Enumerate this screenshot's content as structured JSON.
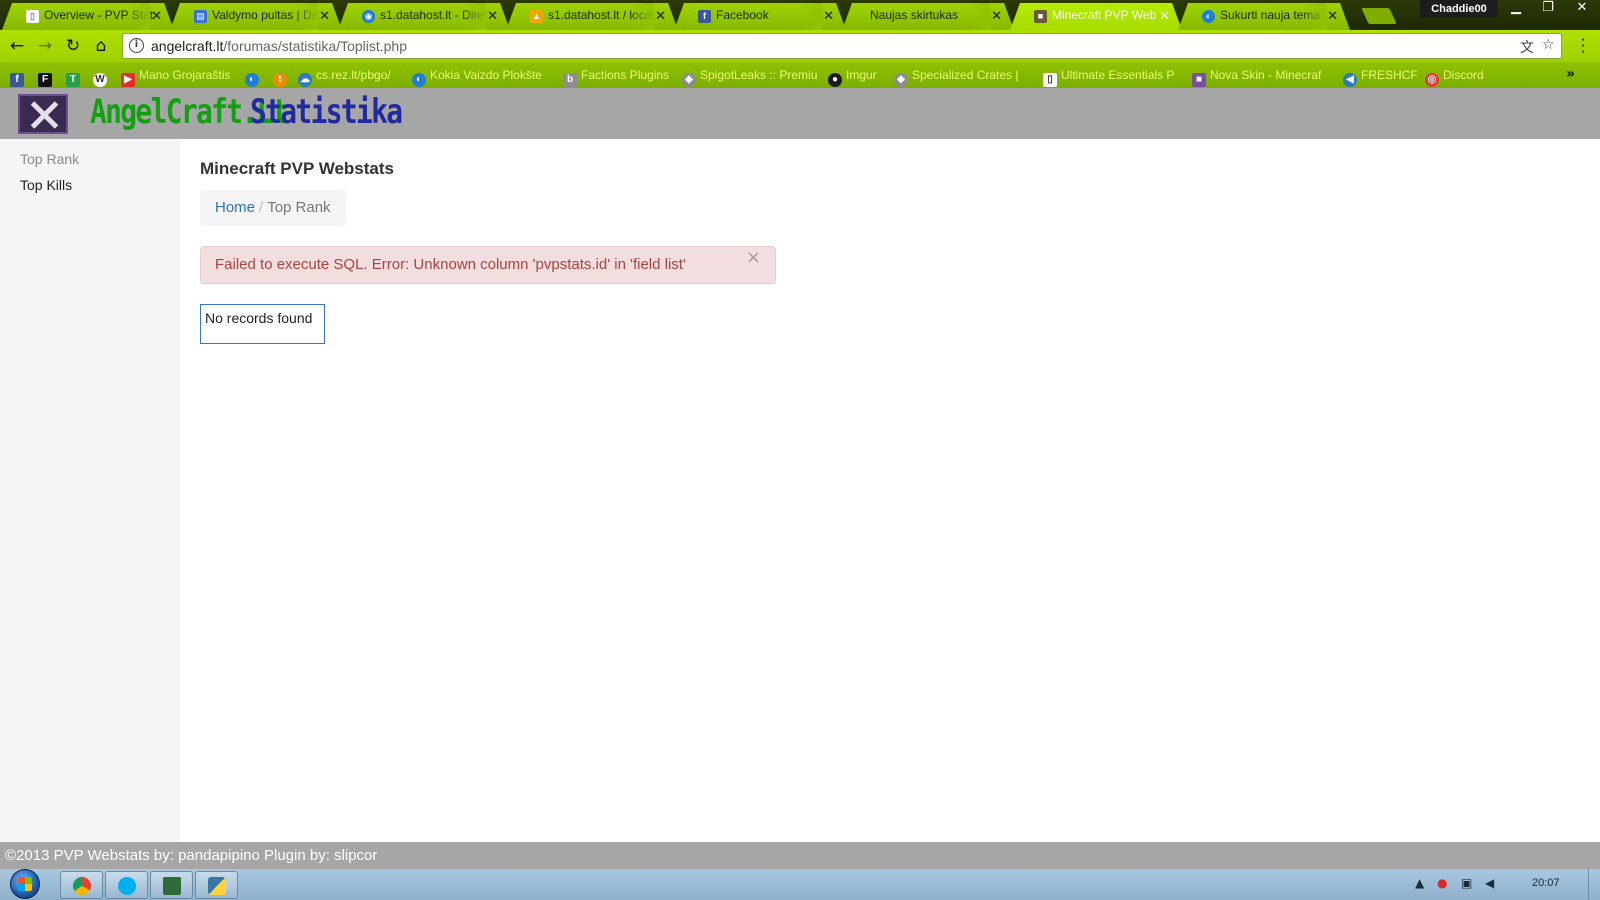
{
  "browser": {
    "tabs": [
      {
        "title": "Overview - PVP Stat",
        "icon": "document-icon",
        "color": "#ffffff",
        "active": false
      },
      {
        "title": "Valdymo pultas | Da",
        "icon": "dashboard-icon",
        "color": "#3b6fd8",
        "active": false
      },
      {
        "title": "s1.datahost.lt - Dire",
        "icon": "globe-icon",
        "color": "#1f7bd6",
        "active": false
      },
      {
        "title": "s1.datahost.lt / local",
        "icon": "phpmyadmin-icon",
        "color": "#f0a800",
        "active": false
      },
      {
        "title": "Facebook",
        "icon": "facebook-icon",
        "color": "#3b5998",
        "active": false
      },
      {
        "title": "Naujas skirtukas",
        "icon": "",
        "color": "",
        "active": false
      },
      {
        "title": "Minecraft PVP Web",
        "icon": "minecraft-icon",
        "color": "#6b5a3a",
        "active": true
      },
      {
        "title": "Sukurti nauja tema",
        "icon": "swirl-icon",
        "color": "#1d7fd6",
        "active": false
      }
    ],
    "profile_name": "Chaddie00",
    "address": {
      "host": "angelcraft.lt",
      "path": "/forumas/statistika/Toplist.php"
    },
    "bookmarks": [
      {
        "label": "",
        "icon": "facebook-icon",
        "color": "#3b5998"
      },
      {
        "label": "",
        "icon": "f-icon",
        "color": "#111111"
      },
      {
        "label": "",
        "icon": "tv-icon",
        "color": "#2a9d4a"
      },
      {
        "label": "",
        "icon": "wordpress-icon",
        "color": "#ffffff"
      },
      {
        "label": "Mano Grojaraštis",
        "icon": "youtube-icon",
        "color": "#e52d27"
      },
      {
        "label": "",
        "icon": "swirl-icon",
        "color": "#1d7fd6"
      },
      {
        "label": "",
        "icon": "tv-orange-icon",
        "color": "#f08a00"
      },
      {
        "label": "cs.rez.lt/pbgo/",
        "icon": "cloud-icon",
        "color": "#2b78c5"
      },
      {
        "label": "Kokia Vaizdo Plokšte",
        "icon": "swirl-icon",
        "color": "#1d7fd6"
      },
      {
        "label": "Factions Plugins",
        "icon": "bukkit-icon",
        "color": "#8d8d8d"
      },
      {
        "label": "SpigotLeaks :: Premiu",
        "icon": "spigot-icon",
        "color": "#8d8d8d"
      },
      {
        "label": "Imgur",
        "icon": "imgur-icon",
        "color": "#1b1b1b"
      },
      {
        "label": "Specialized Crates |",
        "icon": "spigot-icon",
        "color": "#8d8d8d"
      },
      {
        "label": "Ultimate Essentials P",
        "icon": "document-icon",
        "color": "#ffffff"
      },
      {
        "label": "Nova Skin - Minecraf",
        "icon": "novaskin-icon",
        "color": "#7a4fa0"
      },
      {
        "label": "FRESHCF",
        "icon": "arrow-icon",
        "color": "#2b78c5"
      },
      {
        "label": "Discord",
        "icon": "discord-icon",
        "color": "#e53935"
      }
    ]
  },
  "site": {
    "brand": "AngelCraft.Lt",
    "brand_sub": "Statistika",
    "brand_color": "#13a010",
    "brand_sub_color": "#1f2aa0",
    "sidebar": {
      "items": [
        {
          "label": "Top Rank",
          "state": "muted"
        },
        {
          "label": "Top Kills",
          "state": "normal"
        }
      ]
    },
    "main": {
      "title": "Minecraft PVP Webstats",
      "breadcrumb": {
        "home": "Home",
        "separator": "/",
        "current": "Top Rank"
      },
      "alert": {
        "message": "Failed to execute SQL. Error: Unknown column 'pvpstats.id' in 'field list'",
        "close_symbol": "×"
      },
      "empty_message": "No records found"
    },
    "footer": "©2013 PVP Webstats by: pandapipino Plugin by: slipcor"
  },
  "taskbar": {
    "pinned": [
      {
        "icon": "chrome-icon"
      },
      {
        "icon": "skype-icon"
      },
      {
        "icon": "network-app-icon"
      },
      {
        "icon": "python-icon"
      }
    ],
    "clock": "20:07"
  }
}
